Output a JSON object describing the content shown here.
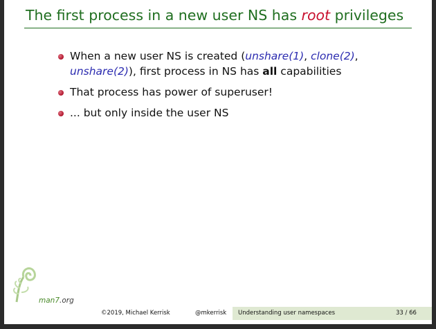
{
  "slide": {
    "title": {
      "prefix": "The first process in a new user NS has ",
      "emphasis": "root",
      "suffix": " privileges"
    },
    "bullets": [
      {
        "part1": "When a new user NS is created (",
        "ref1": "unshare(1)",
        "sep1": ", ",
        "ref2": "clone(2)",
        "sep2": ", ",
        "ref3": "unshare(2)",
        "part2": "), first process in NS has ",
        "bold": "all",
        "part3": " capabilities"
      },
      {
        "text": "That process has power of superuser!"
      },
      {
        "text": "... but only inside the user NS"
      }
    ]
  },
  "logo": {
    "name": "man7",
    "domain": ".org",
    "icon": "fern-fiddlehead-icon"
  },
  "footer": {
    "copyright": "©2019, Michael Kerrisk",
    "handle": "@mkerrisk",
    "section": "Understanding user namespaces",
    "page": "33 / 66"
  },
  "colors": {
    "title": "#1f6e1f",
    "emphasis": "#c8102e",
    "reference": "#2b2bb0",
    "bullet": "#b0142c",
    "footer_band": "#dfe9d2"
  }
}
